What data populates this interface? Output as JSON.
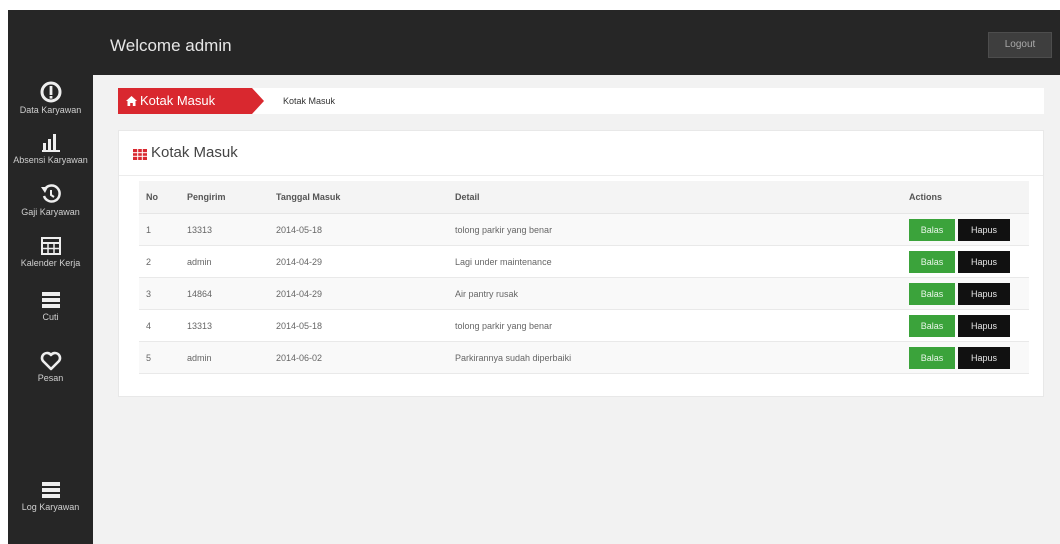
{
  "header": {
    "welcome_text": "Welcome admin",
    "logout_label": "Logout"
  },
  "sidebar": {
    "items": [
      {
        "label": "Data Karyawan",
        "icon": "info-icon"
      },
      {
        "label": "Absensi Karyawan",
        "icon": "bar-chart-icon"
      },
      {
        "label": "Gaji Karyawan",
        "icon": "history-icon"
      },
      {
        "label": "Kalender Kerja",
        "icon": "calendar-grid-icon"
      },
      {
        "label": "Cuti",
        "icon": "list-icon"
      },
      {
        "label": "Pesan",
        "icon": "heart-icon"
      },
      {
        "label": "Log Karyawan",
        "icon": "list-icon"
      }
    ]
  },
  "breadcrumb": {
    "main_label": "Kotak Masuk",
    "sub_label": "Kotak Masuk"
  },
  "panel": {
    "title": "Kotak Masuk"
  },
  "table": {
    "headers": [
      "No",
      "Pengirim",
      "Tanggal Masuk",
      "Detail",
      "Actions"
    ],
    "rows": [
      {
        "no": "1",
        "pengirim": "13313",
        "tanggal": "2014-05-18",
        "detail": "tolong parkir yang benar"
      },
      {
        "no": "2",
        "pengirim": "admin",
        "tanggal": "2014-04-29",
        "detail": "Lagi under maintenance"
      },
      {
        "no": "3",
        "pengirim": "14864",
        "tanggal": "2014-04-29",
        "detail": "Air pantry rusak"
      },
      {
        "no": "4",
        "pengirim": "13313",
        "tanggal": "2014-05-18",
        "detail": "tolong parkir yang benar"
      },
      {
        "no": "5",
        "pengirim": "admin",
        "tanggal": "2014-06-02",
        "detail": "Parkirannya sudah diperbaiki"
      }
    ],
    "balas_label": "Balas",
    "hapus_label": "Hapus"
  },
  "colors": {
    "accent_red": "#d9282f",
    "balas_green": "#3ba33b",
    "hapus_black": "#111111",
    "dark_bar": "#262626"
  }
}
